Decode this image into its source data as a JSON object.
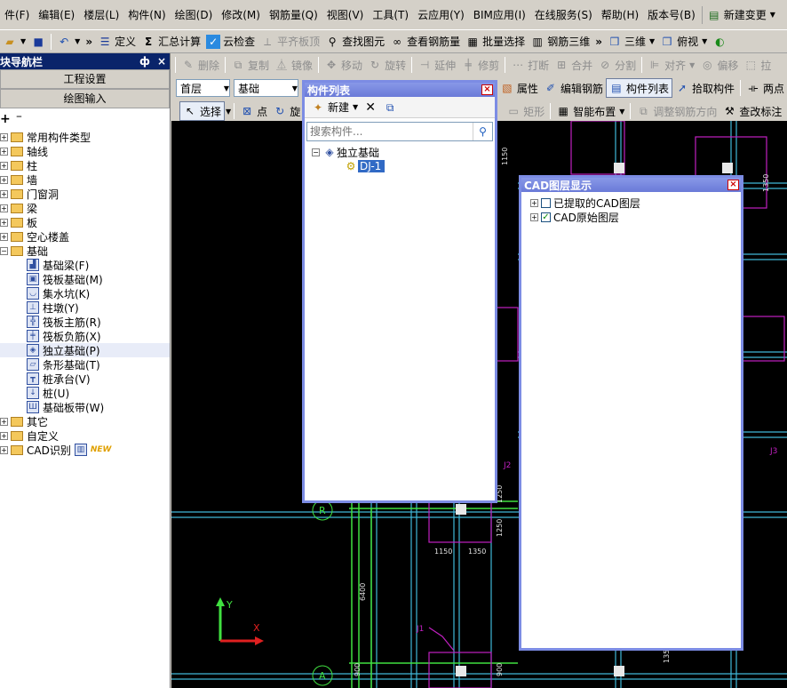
{
  "menu": [
    "件(F)",
    "编辑(E)",
    "楼层(L)",
    "构件(N)",
    "绘图(D)",
    "修改(M)",
    "钢筋量(Q)",
    "视图(V)",
    "工具(T)",
    "云应用(Y)",
    "BIM应用(I)",
    "在线服务(S)",
    "帮助(H)",
    "版本号(B)",
    "新建变更"
  ],
  "toolbar1": {
    "define": "定义",
    "sum": "汇总计算",
    "cloud_check": "云检查",
    "flush_slab": "平齐板顶",
    "find_element": "查找图元",
    "view_rebar": "查看钢筋量",
    "batch_select": "批量选择",
    "rebar_3d": "钢筋三维",
    "view_3d": "三维",
    "top_view": "俯视"
  },
  "toolbar2": {
    "delete": "删除",
    "copy": "复制",
    "mirror": "镜像",
    "move": "移动",
    "rotate": "旋转",
    "extend": "延伸",
    "trim": "修剪",
    "break": "打断",
    "merge": "合并",
    "split": "分割",
    "align": "对齐",
    "offset": "偏移",
    "stretch": "拉"
  },
  "toolbar3": {
    "floor": "首层",
    "category": "基础",
    "attribute": "属性",
    "edit_rebar": "编辑钢筋",
    "component_list": "构件列表",
    "pick": "拾取构件",
    "two_points": "两点"
  },
  "toolbar4": {
    "select": "选择",
    "point": "点",
    "rotate_point": "旋",
    "rectangle": "矩形",
    "smart_layout": "智能布置",
    "adjust_rebar_dir": "调整钢筋方向",
    "check_label": "查改标注"
  },
  "nav": {
    "title": "块导航栏",
    "pin": "ф",
    "close": "×",
    "project_settings": "工程设置",
    "drawing_input": "绘图输入",
    "tree_top": [
      {
        "label": "常用构件类型",
        "exp": "+"
      },
      {
        "label": "轴线",
        "exp": "+"
      },
      {
        "label": "柱",
        "exp": "+"
      },
      {
        "label": "墙",
        "exp": "+"
      },
      {
        "label": "门窗洞",
        "exp": "+"
      },
      {
        "label": "梁",
        "exp": "+"
      },
      {
        "label": "板",
        "exp": "+"
      },
      {
        "label": "空心楼盖",
        "exp": "+"
      },
      {
        "label": "基础",
        "exp": "-"
      }
    ],
    "foundation_children": [
      {
        "label": "基础梁(F)",
        "icon": "foundation-beam-icon"
      },
      {
        "label": "筏板基础(M)",
        "icon": "raft-foundation-icon"
      },
      {
        "label": "集水坑(K)",
        "icon": "sump-icon"
      },
      {
        "label": "柱墩(Y)",
        "icon": "column-pier-icon"
      },
      {
        "label": "筏板主筋(R)",
        "icon": "raft-main-rebar-icon"
      },
      {
        "label": "筏板负筋(X)",
        "icon": "raft-negative-rebar-icon"
      },
      {
        "label": "独立基础(P)",
        "icon": "isolated-foundation-icon"
      },
      {
        "label": "条形基础(T)",
        "icon": "strip-foundation-icon"
      },
      {
        "label": "桩承台(V)",
        "icon": "pile-cap-icon"
      },
      {
        "label": "桩(U)",
        "icon": "pile-icon"
      },
      {
        "label": "基础板带(W)",
        "icon": "foundation-strip-icon"
      }
    ],
    "tree_bottom": [
      {
        "label": "其它",
        "exp": "+"
      },
      {
        "label": "自定义",
        "exp": "+"
      },
      {
        "label": "CAD识别",
        "exp": "+",
        "badge": "NEW"
      }
    ]
  },
  "component_panel": {
    "title": "构件列表",
    "new_label": "新建",
    "search_placeholder": "搜索构件...",
    "root": "独立基础",
    "child": "DJ-1"
  },
  "cad_panel": {
    "title": "CAD图层显示",
    "layers": [
      {
        "label": "已提取的CAD图层",
        "checked": false
      },
      {
        "label": "CAD原始图层",
        "checked": true
      }
    ]
  },
  "cad": {
    "axis_r": "R",
    "axis_a": "A",
    "dims": [
      "1150",
      "1350",
      "1250",
      "1250",
      "6400",
      "1150",
      "1350",
      "900",
      "900",
      "1350"
    ],
    "labels": [
      "J2",
      "J1",
      "J3"
    ]
  },
  "colors": {
    "title_blue": "#0a246a",
    "panel_border": "#7c8ce4",
    "cad_magenta": "#c020c0",
    "cad_cyan": "#40c0e0",
    "cad_green": "#40e040"
  }
}
